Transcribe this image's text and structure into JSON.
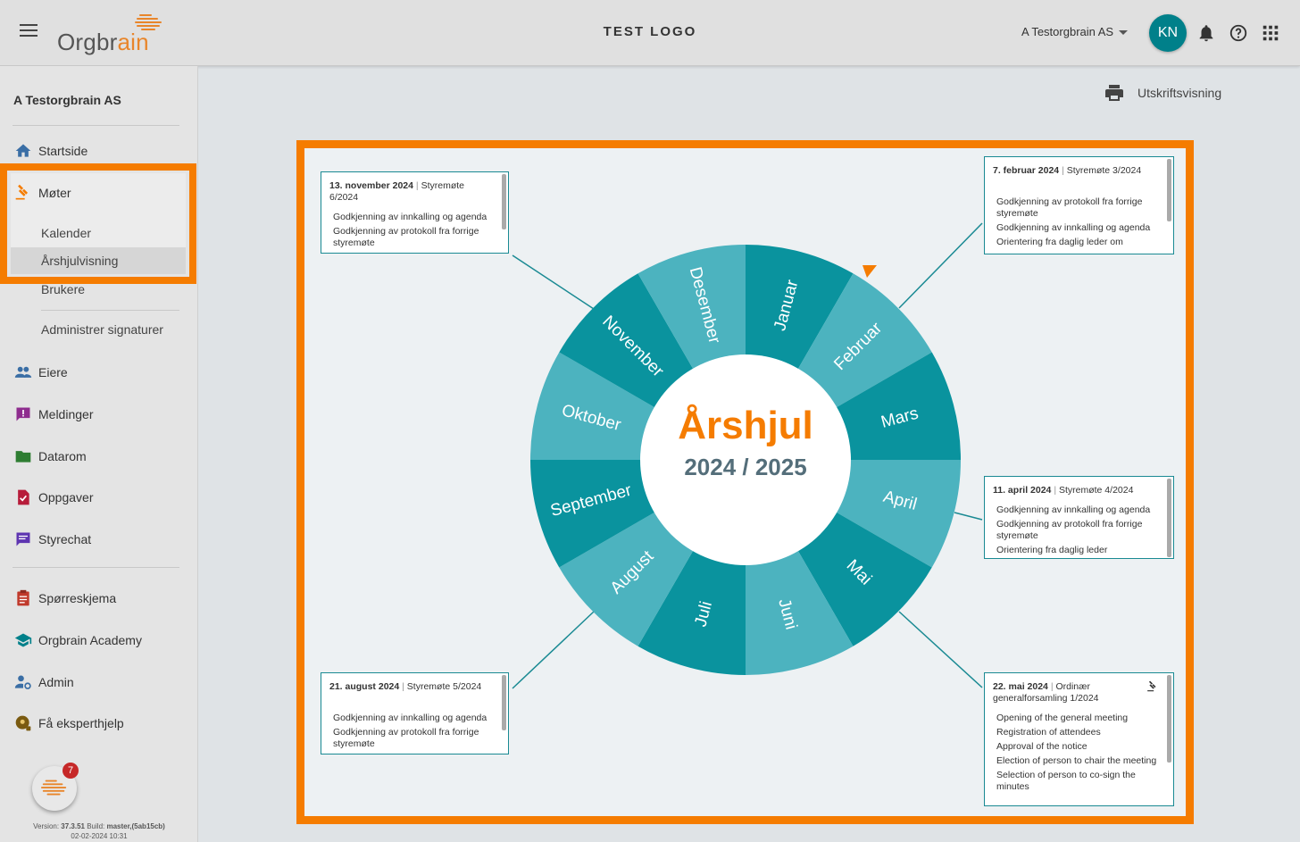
{
  "header": {
    "logo_text_main": "Orgbr",
    "logo_text_accent": "ain",
    "center_logo": "TEST LOGO",
    "company_selector": "A Testorgbrain AS",
    "avatar_initials": "KN"
  },
  "sidebar": {
    "org_name": "A Testorgbrain AS",
    "items": [
      {
        "label": "Startside",
        "icon": "home-icon"
      },
      {
        "label": "Møter",
        "icon": "gavel-icon"
      },
      {
        "label": "Kalender"
      },
      {
        "label": "Årshjulvisning"
      },
      {
        "label": "Brukere"
      },
      {
        "label": "Administrer signaturer"
      },
      {
        "label": "Eiere",
        "icon": "people-icon"
      },
      {
        "label": "Meldinger",
        "icon": "message-icon"
      },
      {
        "label": "Datarom",
        "icon": "folder-icon"
      },
      {
        "label": "Oppgaver",
        "icon": "task-icon"
      },
      {
        "label": "Styrechat",
        "icon": "chat-icon"
      },
      {
        "label": "Spørreskjema",
        "icon": "clipboard-icon"
      },
      {
        "label": "Orgbrain Academy",
        "icon": "school-icon"
      },
      {
        "label": "Admin",
        "icon": "admin-icon"
      },
      {
        "label": "Få eksperthjelp",
        "icon": "expert-icon"
      }
    ],
    "help_badge_count": "7",
    "version_line1_prefix": "Version: ",
    "version_number": "37.3.51",
    "version_line1_mid": " Build: ",
    "version_build": "master,(5ab15cb)",
    "version_line2": "02-02-2024 10:31"
  },
  "toolbar": {
    "print_label": "Utskriftsvisning"
  },
  "wheel": {
    "title": "Årshjul",
    "years": "2024 / 2025",
    "colors": {
      "dark": "#0a939e",
      "light": "#4cb3bf",
      "accent": "#f57c00",
      "line": "#1a8a93"
    },
    "months": [
      "Januar",
      "Februar",
      "Mars",
      "April",
      "Mai",
      "Juni",
      "Juli",
      "August",
      "September",
      "Oktober",
      "November",
      "Desember"
    ]
  },
  "cards": [
    {
      "date": "13. november 2024",
      "title": "Styremøte 6/2024",
      "items": [
        "Godkjenning av innkalling og agenda",
        "Godkjenning av protokoll fra forrige styremøte"
      ]
    },
    {
      "date": "7. februar 2024",
      "title": "Styremøte 3/2024",
      "items": [
        "Godkjenning av protokoll fra forrige styremøte",
        "Godkjenning av innkalling og agenda",
        "Orientering fra daglig leder om"
      ]
    },
    {
      "date": "11. april 2024",
      "title": "Styremøte 4/2024",
      "items": [
        "Godkjenning av innkalling og agenda",
        "Godkjenning av protokoll fra forrige styremøte",
        "Orientering fra daglig leder"
      ]
    },
    {
      "date": "21. august 2024",
      "title": "Styremøte 5/2024",
      "items": [
        "Godkjenning av innkalling og agenda",
        "Godkjenning av protokoll fra forrige styremøte"
      ]
    },
    {
      "date": "22. mai 2024",
      "title": "Ordinær generalforsamling 1/2024",
      "items": [
        "Opening of the general meeting",
        "Registration of attendees",
        "Approval of the notice",
        "Election of person to chair the meeting",
        "Selection of person to co-sign the minutes"
      ]
    }
  ]
}
